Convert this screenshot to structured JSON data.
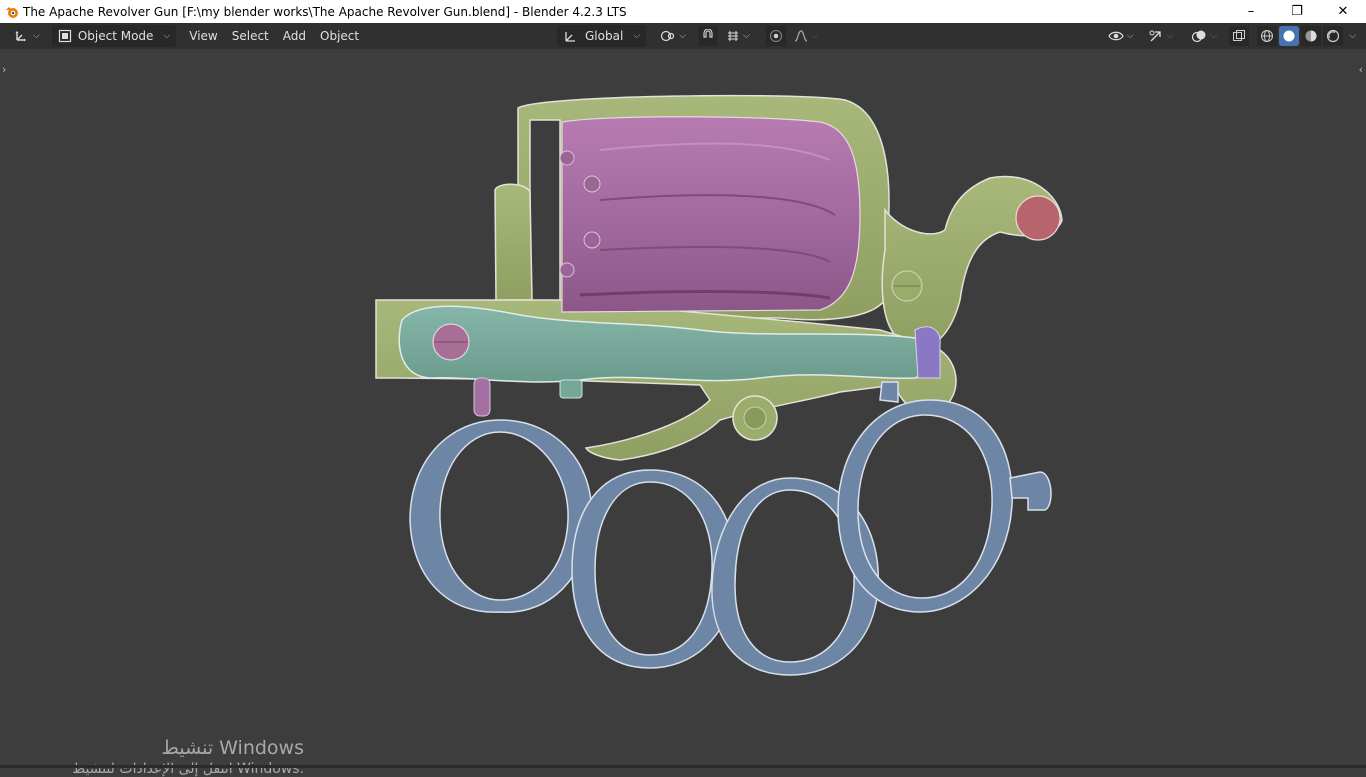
{
  "window": {
    "title": "The Apache Revolver Gun [F:\\my blender works\\The Apache Revolver Gun.blend] - Blender 4.2.3 LTS",
    "controls": {
      "minimize": "–",
      "maximize": "❐",
      "close": "✕"
    }
  },
  "header": {
    "mode_label": "Object Mode",
    "menus": [
      "View",
      "Select",
      "Add",
      "Object"
    ],
    "transform_orientation": "Global"
  },
  "viewport": {
    "shading_active": "solid"
  },
  "watermark": {
    "line1": "تنشيط Windows",
    "line2": "انتقل إلى الإعدادات لتنشيط Windows."
  },
  "colors": {
    "frame_green": "#9fb06f",
    "cylinder_pink": "#a76aa2",
    "grip_teal": "#76a89a",
    "knuckles_blue": "#6d86a6",
    "pin_red": "#b8646c",
    "accent_blue": "#4772b3"
  }
}
